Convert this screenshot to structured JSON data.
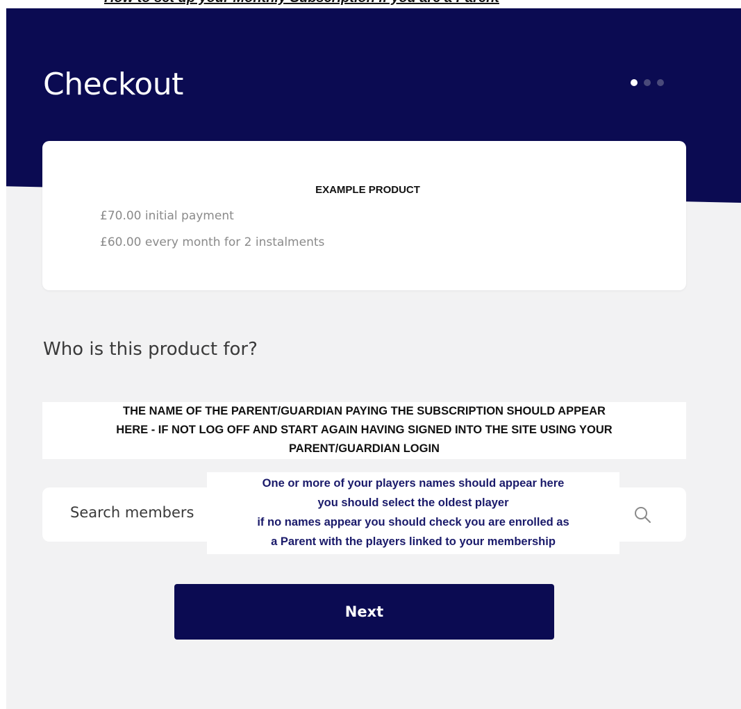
{
  "annotation_title": "How to set up your Monthly Subscription if you are a Parent",
  "page": {
    "title": "Checkout",
    "steps": [
      {
        "label": "step-1",
        "active": true
      },
      {
        "label": "step-2",
        "active": false
      },
      {
        "label": "step-3",
        "active": false
      }
    ]
  },
  "product": {
    "name": "EXAMPLE PRODUCT",
    "initial_payment": "£70.00 initial payment",
    "recurring": "£60.00 every month for 2 instalments"
  },
  "question": "Who is this product for?",
  "guardian_note": [
    "THE NAME OF THE PARENT/GUARDIAN PAYING THE SUBSCRIPTION SHOULD APPEAR",
    "HERE - IF NOT LOG OFF AND START AGAIN HAVING SIGNED INTO THE SITE USING YOUR",
    "PARENT/GUARDIAN LOGIN"
  ],
  "search": {
    "placeholder": "Search members",
    "icon": "search-icon"
  },
  "players_note": [
    "One or more of your players names should appear here",
    "you should select the oldest player",
    "if no names appear you should check you are enrolled as",
    "a Parent with the players linked to your membership"
  ],
  "next_button": "Next",
  "colors": {
    "brand_navy": "#0b0b52",
    "background": "#f2f2f3",
    "card": "#ffffff",
    "muted_text": "#8a8a8a",
    "annotation_blue": "#1a1a6a"
  }
}
